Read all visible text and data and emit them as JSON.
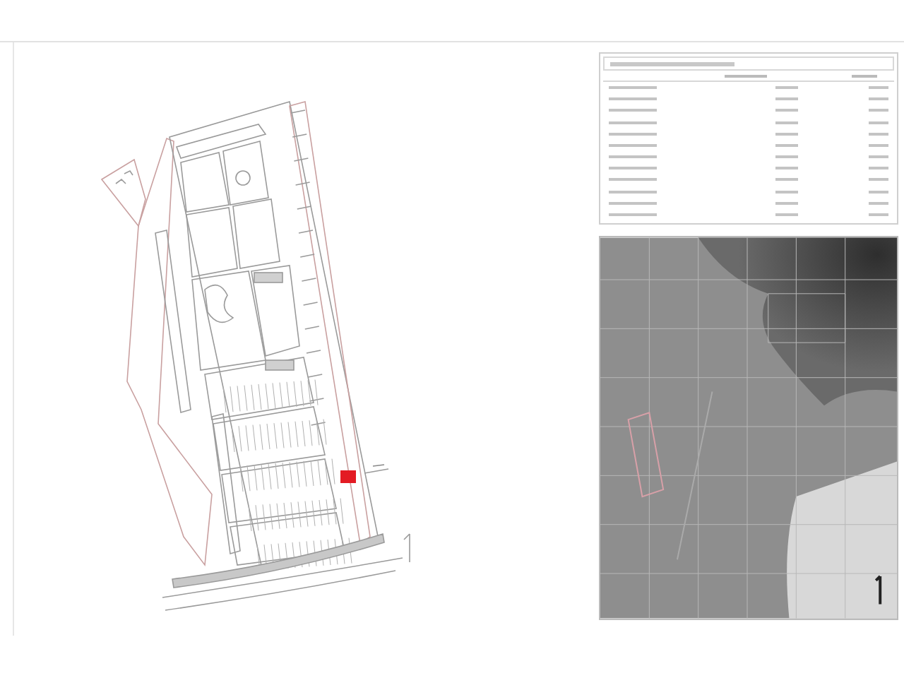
{
  "sheets": [
    {
      "kind": "site-plan"
    },
    {
      "kind": "parameters-table"
    },
    {
      "kind": "aerial-photo"
    }
  ]
}
